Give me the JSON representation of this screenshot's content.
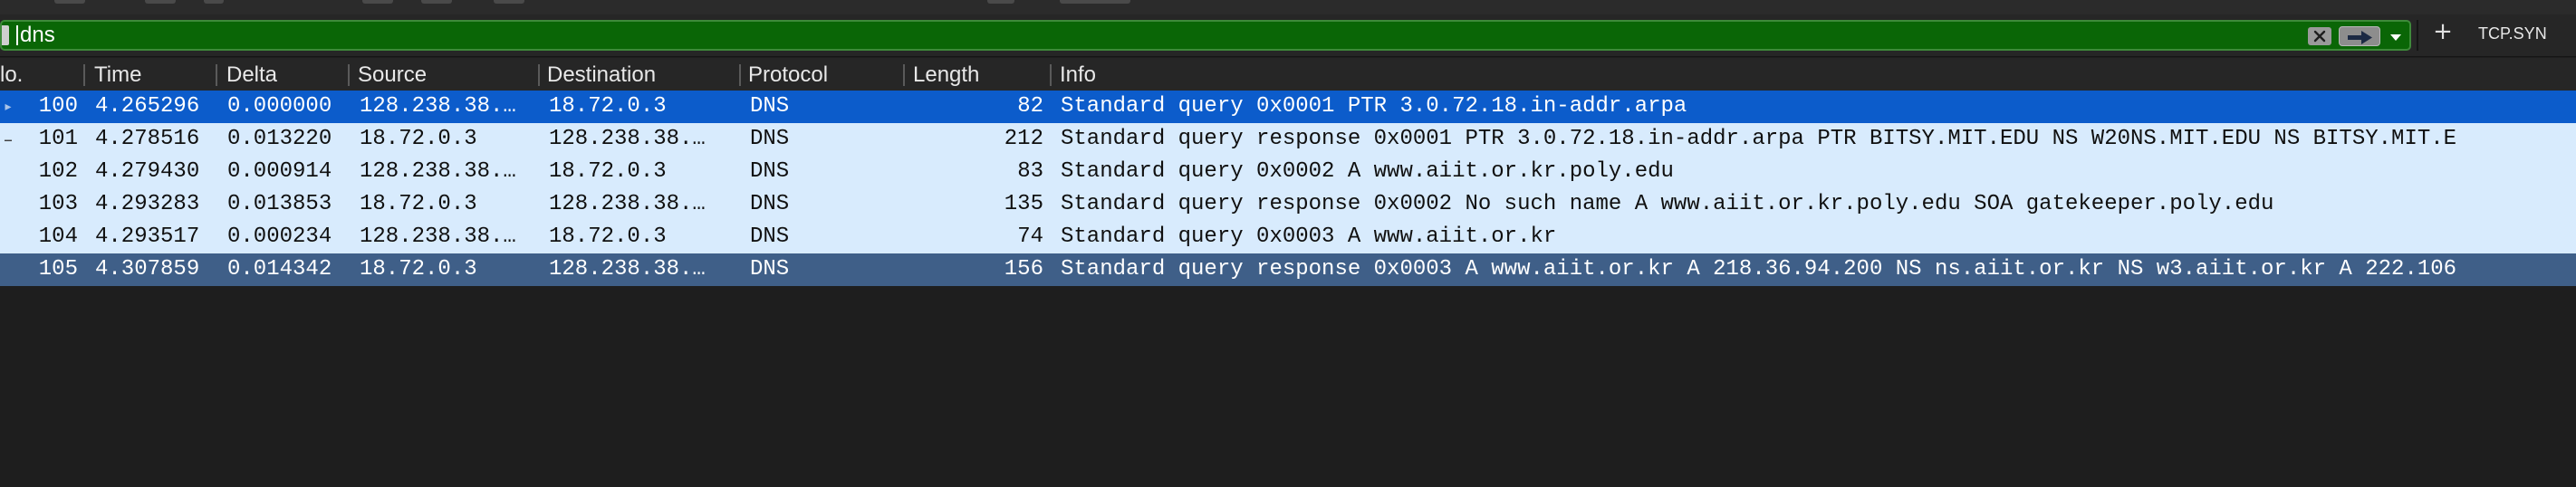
{
  "filter": {
    "value": "dns",
    "apply_label": "",
    "bookmark_button_label": "TCP.SYN"
  },
  "columns": [
    "No.",
    "Time",
    "Delta",
    "Source",
    "Destination",
    "Protocol",
    "Length",
    "Info"
  ],
  "columns_visible": [
    "lo.",
    "Time",
    "Delta",
    "Source",
    "Destination",
    "Protocol",
    "Length",
    "Info"
  ],
  "packets": [
    {
      "no": "100",
      "time": "4.265296",
      "delta": "0.000000",
      "source": "128.238.38.…",
      "destination": "18.72.0.3",
      "protocol": "DNS",
      "length": "82",
      "info": "Standard query 0x0001 PTR 3.0.72.18.in-addr.arpa",
      "state": "selected",
      "marker": "▸"
    },
    {
      "no": "101",
      "time": "4.278516",
      "delta": "0.013220",
      "source": "18.72.0.3",
      "destination": "128.238.38.…",
      "protocol": "DNS",
      "length": "212",
      "info": "Standard query response 0x0001 PTR 3.0.72.18.in-addr.arpa PTR BITSY.MIT.EDU NS W20NS.MIT.EDU NS BITSY.MIT.E",
      "state": "normal",
      "marker": "–"
    },
    {
      "no": "102",
      "time": "4.279430",
      "delta": "0.000914",
      "source": "128.238.38.…",
      "destination": "18.72.0.3",
      "protocol": "DNS",
      "length": "83",
      "info": "Standard query 0x0002 A www.aiit.or.kr.poly.edu",
      "state": "normal",
      "marker": ""
    },
    {
      "no": "103",
      "time": "4.293283",
      "delta": "0.013853",
      "source": "18.72.0.3",
      "destination": "128.238.38.…",
      "protocol": "DNS",
      "length": "135",
      "info": "Standard query response 0x0002 No such name A www.aiit.or.kr.poly.edu SOA gatekeeper.poly.edu",
      "state": "normal",
      "marker": ""
    },
    {
      "no": "104",
      "time": "4.293517",
      "delta": "0.000234",
      "source": "128.238.38.…",
      "destination": "18.72.0.3",
      "protocol": "DNS",
      "length": "74",
      "info": "Standard query 0x0003 A www.aiit.or.kr",
      "state": "normal",
      "marker": ""
    },
    {
      "no": "105",
      "time": "4.307859",
      "delta": "0.014342",
      "source": "18.72.0.3",
      "destination": "128.238.38.…",
      "protocol": "DNS",
      "length": "156",
      "info": "Standard query response 0x0003 A www.aiit.or.kr A 218.36.94.200 NS ns.aiit.or.kr NS w3.aiit.or.kr A 222.106",
      "state": "highlight",
      "marker": ""
    }
  ],
  "colors": {
    "filter_valid_bg": "#0a6606",
    "row_bg": "#d8ebfd",
    "row_selected_bg": "#0c5ccb",
    "row_highlight_bg": "#3f5f88",
    "background": "#1e1e1e"
  },
  "icons": {
    "clear": "close-icon",
    "apply": "arrow-right-icon",
    "dropdown": "chevron-down-icon",
    "add": "plus-icon"
  }
}
